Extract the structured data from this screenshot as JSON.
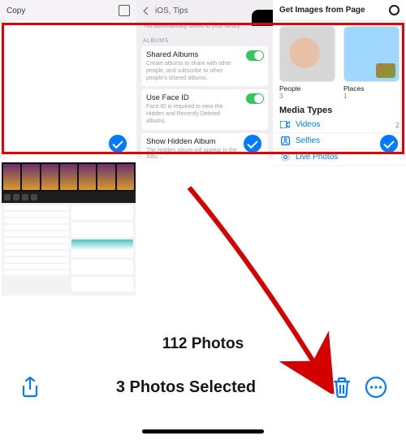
{
  "col1": {
    "action_label": "Copy"
  },
  "col2": {
    "crumb_label": "iOS, Tips",
    "top_desc": "not automatically saved to your library.",
    "section_label": "ALBUMS",
    "shared_albums": {
      "title": "Shared Albums",
      "desc": "Create albums to share with other people, and subscribe to other people's shared albums."
    },
    "face_id": {
      "title": "Use Face ID",
      "desc": "Face ID is required to view the Hidden and Recently Deleted albums."
    },
    "hidden": {
      "title": "Show Hidden Album",
      "desc": "The Hidden album will appear in the Albu..."
    }
  },
  "col3": {
    "header": "Get Images from Page",
    "album_people_label": "People",
    "album_people_count": "3",
    "album_places_label": "Places",
    "album_places_count": "1",
    "media_types_label": "Media Types",
    "videos_label": "Videos",
    "videos_count": "2",
    "selfies_label": "Selfies",
    "live_label": "Live Photos"
  },
  "photos_count_text": "112 Photos",
  "selected_text": "3 Photos Selected",
  "annotation": "Arrow pointing to trash (delete) button"
}
